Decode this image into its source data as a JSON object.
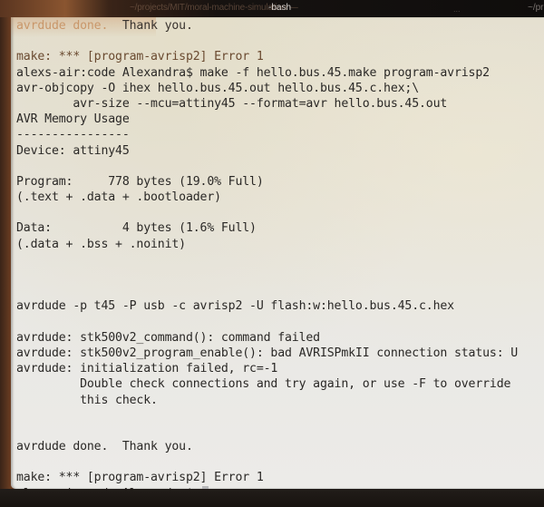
{
  "window": {
    "title_path": "~/projects/MIT/moral-machine-simulation",
    "title_separator": "—",
    "title_process": "-bash",
    "tab_overflow": "...",
    "tab_right_label": "~/pr"
  },
  "terminal": {
    "lines": [
      {
        "text": "avrdude done.  ",
        "tail": "Thank you.",
        "style": "faded"
      },
      {
        "text": "",
        "style": "normal"
      },
      {
        "text": "make: *** [program-avrisp2] Error 1",
        "style": "warm"
      },
      {
        "text": "alexs-air:code Alexandra$ make -f hello.bus.45.make program-avrisp2",
        "style": "normal"
      },
      {
        "text": "avr-objcopy -O ihex hello.bus.45.out hello.bus.45.c.hex;\\",
        "style": "normal"
      },
      {
        "text": "        avr-size --mcu=attiny45 --format=avr hello.bus.45.out",
        "style": "normal"
      },
      {
        "text": "AVR Memory Usage",
        "style": "normal"
      },
      {
        "text": "----------------",
        "style": "normal"
      },
      {
        "text": "Device: attiny45",
        "style": "normal"
      },
      {
        "text": "",
        "style": "normal"
      },
      {
        "text": "Program:     778 bytes (19.0% Full)",
        "style": "normal"
      },
      {
        "text": "(.text + .data + .bootloader)",
        "style": "normal"
      },
      {
        "text": "",
        "style": "normal"
      },
      {
        "text": "Data:          4 bytes (1.6% Full)",
        "style": "normal"
      },
      {
        "text": "(.data + .bss + .noinit)",
        "style": "normal"
      },
      {
        "text": "",
        "style": "normal"
      },
      {
        "text": "",
        "style": "normal"
      },
      {
        "text": "",
        "style": "normal"
      },
      {
        "text": "avrdude -p t45 -P usb -c avrisp2 -U flash:w:hello.bus.45.c.hex",
        "style": "normal"
      },
      {
        "text": "",
        "style": "normal"
      },
      {
        "text": "avrdude: stk500v2_command(): command failed",
        "style": "normal"
      },
      {
        "text": "avrdude: stk500v2_program_enable(): bad AVRISPmkII connection status: U",
        "style": "normal"
      },
      {
        "text": "avrdude: initialization failed, rc=-1",
        "style": "normal"
      },
      {
        "text": "         Double check connections and try again, or use -F to override",
        "style": "normal"
      },
      {
        "text": "         this check.",
        "style": "normal"
      },
      {
        "text": "",
        "style": "normal"
      },
      {
        "text": "",
        "style": "normal"
      },
      {
        "text": "avrdude done.  Thank you.",
        "style": "normal"
      },
      {
        "text": "",
        "style": "normal"
      },
      {
        "text": "make: *** [program-avrisp2] Error 1",
        "style": "normal"
      },
      {
        "text": "alexs-air:code Alexandra$ ",
        "style": "prompt"
      }
    ]
  }
}
